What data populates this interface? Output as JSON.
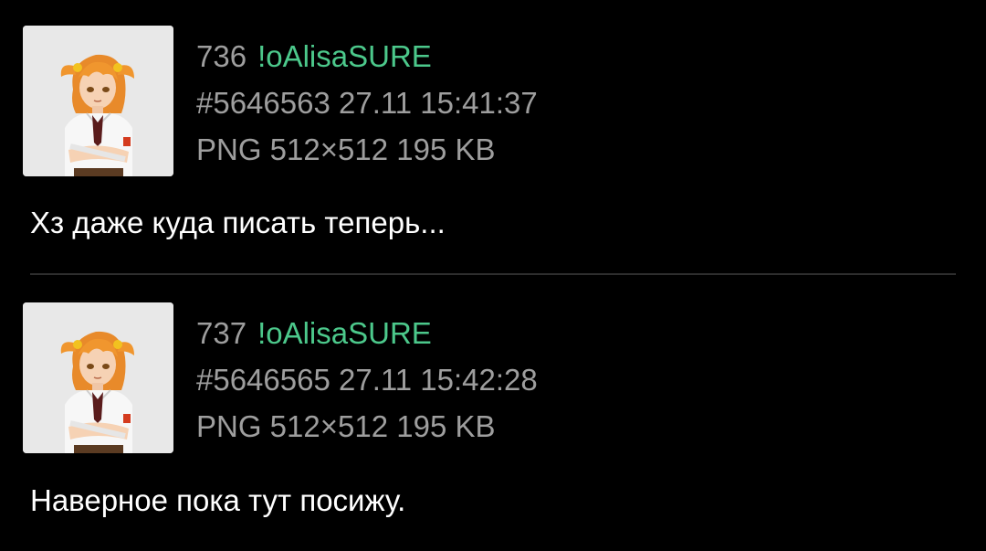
{
  "colors": {
    "background": "#000000",
    "meta_text": "#9e9e9e",
    "tripcode": "#4cc88b",
    "comment_text": "#ffffff",
    "divider": "#2e2e2e"
  },
  "posts": [
    {
      "number": "736",
      "name": "!oAlisaSURE",
      "id_datetime": "#5646563 27.11 15:41:37",
      "file_info": "PNG 512×512 195 KB",
      "comment": "Хз даже куда писать теперь...",
      "thumbnail_icon": "anime-girl-avatar"
    },
    {
      "number": "737",
      "name": "!oAlisaSURE",
      "id_datetime": "#5646565 27.11 15:42:28",
      "file_info": "PNG 512×512 195 KB",
      "comment": "Наверное пока тут посижу.",
      "thumbnail_icon": "anime-girl-avatar"
    }
  ]
}
